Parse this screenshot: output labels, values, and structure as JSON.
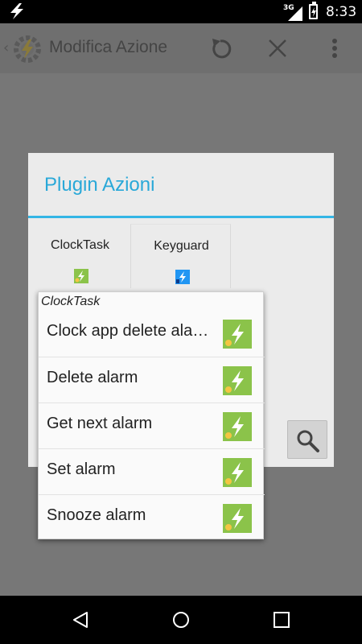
{
  "status_bar": {
    "time": "8:33",
    "network": "3G"
  },
  "app_bar": {
    "title": "Modifica Azione"
  },
  "dialog": {
    "title": "Plugin Azioni",
    "plugins": [
      {
        "label": "ClockTask"
      },
      {
        "label": "Keyguard"
      }
    ]
  },
  "popup": {
    "header": "ClockTask",
    "items": [
      {
        "label": "Clock app delete ala…"
      },
      {
        "label": "Delete alarm"
      },
      {
        "label": "Get next alarm"
      },
      {
        "label": "Set alarm"
      },
      {
        "label": "Snooze alarm"
      }
    ]
  },
  "colors": {
    "accent": "#33b5e5",
    "plugin_green": "#8bc34a",
    "keyguard_blue": "#2196f3"
  },
  "icons": [
    "bolt-icon",
    "signal-icon",
    "battery-icon",
    "tasker-app-icon",
    "undo-icon",
    "close-icon",
    "more-icon",
    "search-icon",
    "back-icon",
    "home-icon",
    "recents-icon"
  ]
}
